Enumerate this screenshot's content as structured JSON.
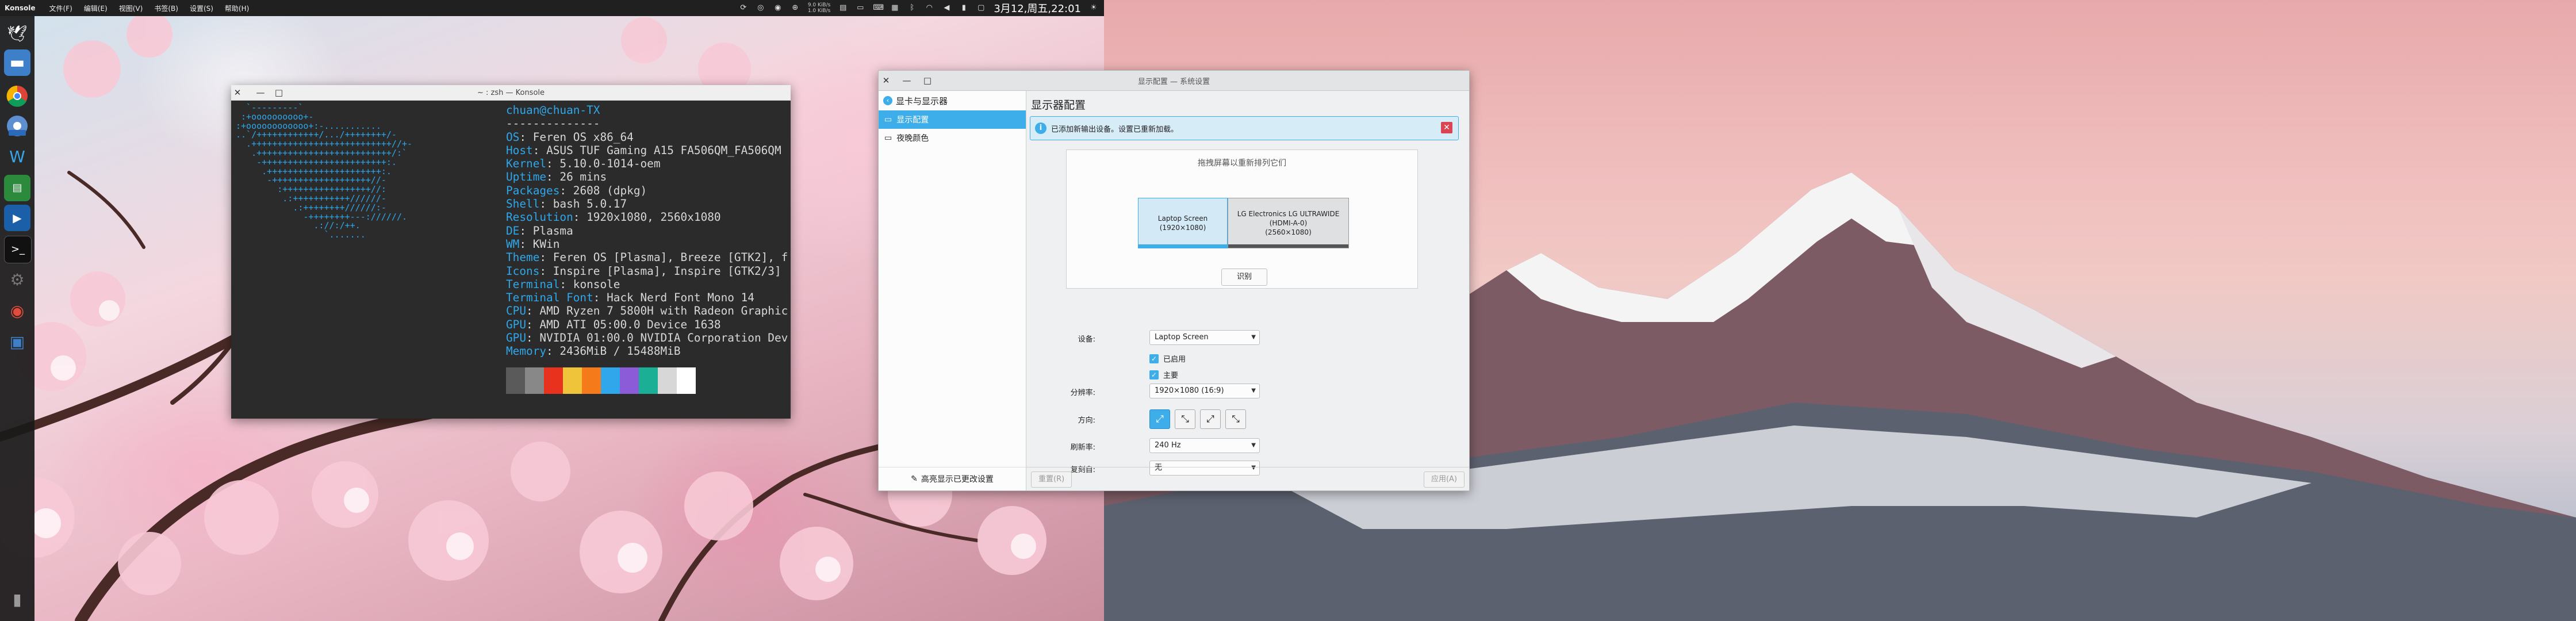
{
  "top_panel": {
    "app_name": "Konsole",
    "menus": [
      "文件(F)",
      "编辑(E)",
      "视图(V)",
      "书签(B)",
      "设置(S)",
      "帮助(H)"
    ],
    "net_speed_up": "9.0 KiB/s",
    "net_speed_down": "1.0 KiB/s",
    "clock": "3月12,周五,22:01"
  },
  "dock": {
    "items": [
      "konsole-icon",
      "file-manager-icon",
      "chrome-icon",
      "chrome-dev-icon",
      "vscode-icon",
      "terminal-green-icon",
      "tasks-icon",
      "terminal-icon",
      "settings-icon",
      "software-center-icon",
      "system-settings-icon",
      "trash-icon"
    ]
  },
  "konsole": {
    "title": "~ : zsh — Konsole",
    "logo_lines": [
      "  `---------`",
      " :+oooooooooo+-",
      ":+oooooooooooo+:-...........",
      "..`/++++++++++++/.../++++++++/-",
      "  .+++++++++++++++++++++++++++//+-",
      "   .++++++++++++++++++++++++++/:`",
      "    -++++++++++++++++++++++++:.",
      "     .++++++++++++++++++++++:.",
      "      -+++++++++++++++++++//-",
      "        :+++++++++++++++++//:",
      "         .:+++++++++++//////-",
      "           .:++++++++//////:-",
      "             -++++++++---://////.",
      "               .://:/++.",
      "                 `.......",
      ""
    ],
    "info": [
      {
        "key": "",
        "val": "chuan@chuan-TX",
        "user": true
      },
      {
        "key": "",
        "val": "--------------"
      },
      {
        "key": "OS",
        "val": "Feren OS x86_64"
      },
      {
        "key": "Host",
        "val": "ASUS TUF Gaming A15 FA506QM_FA506QM"
      },
      {
        "key": "Kernel",
        "val": "5.10.0-1014-oem"
      },
      {
        "key": "Uptime",
        "val": "26 mins"
      },
      {
        "key": "Packages",
        "val": "2608 (dpkg)"
      },
      {
        "key": "Shell",
        "val": "bash 5.0.17"
      },
      {
        "key": "Resolution",
        "val": "1920x1080, 2560x1080"
      },
      {
        "key": "DE",
        "val": "Plasma"
      },
      {
        "key": "WM",
        "val": "KWin"
      },
      {
        "key": "Theme",
        "val": "Feren OS [Plasma], Breeze [GTK2], f"
      },
      {
        "key": "Icons",
        "val": "Inspire [Plasma], Inspire [GTK2/3]"
      },
      {
        "key": "Terminal",
        "val": "konsole"
      },
      {
        "key": "Terminal Font",
        "val": "Hack Nerd Font Mono 14"
      },
      {
        "key": "CPU",
        "val": "AMD Ryzen 7 5800H with Radeon Graphic"
      },
      {
        "key": "GPU",
        "val": "AMD ATI 05:00.0 Device 1638"
      },
      {
        "key": "GPU",
        "val": "NVIDIA 01:00.0 NVIDIA Corporation Dev"
      },
      {
        "key": "Memory",
        "val": "2436MiB / 15488MiB"
      }
    ],
    "palette": [
      "#5a5a5a",
      "#888888",
      "#e8321e",
      "#f0c43a",
      "#f57a1a",
      "#2fa7ea",
      "#8c5bd8",
      "#1bb096",
      "#d7d7d7",
      "#ffffff"
    ]
  },
  "settings": {
    "window_title": "显示配置 — 系统设置",
    "breadcrumb": "显卡与显示器",
    "nav_items": [
      {
        "label": "显示配置",
        "active": true
      },
      {
        "label": "夜晚颜色",
        "active": false
      }
    ],
    "sidebar_footer": "高亮显示已更改设置",
    "page_title": "显示器配置",
    "banner": "已添加新输出设备。设置已重新加载。",
    "arrange_hint": "拖拽屏幕以重新排列它们",
    "monitors": [
      {
        "name": "Laptop Screen",
        "res": "(1920×1080)",
        "selected": true
      },
      {
        "name": "LG Electronics LG ULTRAWIDE",
        "sub": "(HDMI-A-0)",
        "res": "(2560×1080)",
        "selected": false
      }
    ],
    "identify": "识别",
    "form": {
      "device_label": "设备:",
      "device_value": "Laptop Screen",
      "enabled_label": "已启用",
      "primary_label": "主要",
      "resolution_label": "分辨率:",
      "resolution_value": "1920×1080 (16:9)",
      "orientation_label": "方向:",
      "refresh_label": "刷新率:",
      "refresh_value": "240 Hz",
      "overscan_label": "复刻自:",
      "overscan_value": "无"
    },
    "reset_button": "重置(R)",
    "apply_button": "应用(A)"
  }
}
